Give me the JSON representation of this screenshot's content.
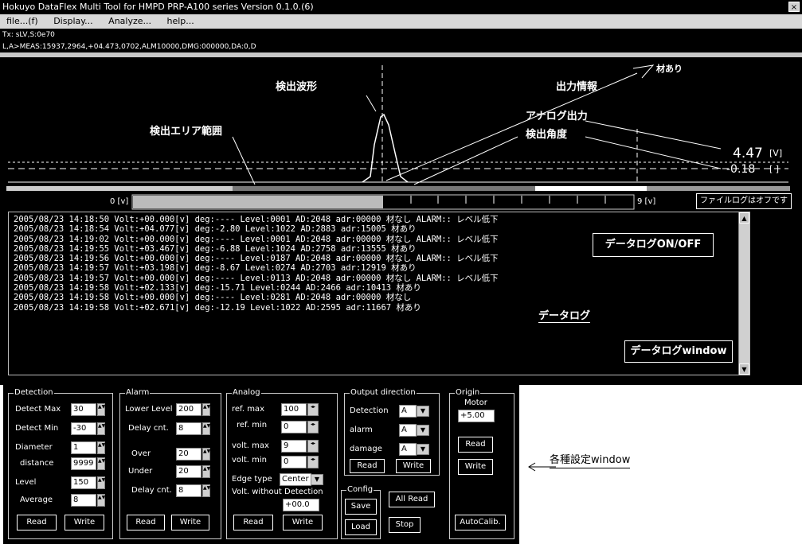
{
  "window": {
    "title": "Hokuyo DataFlex Multi Tool for HMPD PRP-A100 series  Version 0.1.0.(6)",
    "close": "×"
  },
  "menu": [
    "file...(f)",
    "Display...",
    "Analyze...",
    "help..."
  ],
  "status": {
    "line1": "Tx: sLV,S:0e70",
    "line2": "L,A>MEAS:15937,2964,+04.473,0702,ALM10000,DMG:000000,DA:0,D"
  },
  "annotations": {
    "waveform": "検出波形",
    "output_info": "出力情報",
    "area": "検出エリア範囲",
    "analog": "アナログ出力",
    "angle": "検出角度",
    "material": "材あり",
    "datalog_onoff": "データログON/OFF",
    "datalog": "データログ",
    "datalog_window": "データログwindow",
    "settings_window": "各種設定window"
  },
  "readout": {
    "volt": "4.47",
    "volt_unit": "[V]",
    "deg": "-0.18",
    "deg_unit": "[ ]"
  },
  "scale": {
    "min": "0 [v]",
    "max": "9 [v]"
  },
  "log_toggle": "ファイルログはオフです",
  "log": [
    "2005/08/23 14:18:50 Volt:+00.000[v] deg:---- Level:0001 AD:2048 adr:00000 材なし ALARM:: レベル低下",
    "2005/08/23 14:18:54 Volt:+04.077[v] deg:-2.80 Level:1022 AD:2883 adr:15005 材あり",
    "2005/08/23 14:19:02 Volt:+00.000[v] deg:---- Level:0001 AD:2048 adr:00000 材なし ALARM:: レベル低下",
    "2005/08/23 14:19:55 Volt:+03.467[v] deg:-6.88 Level:1024 AD:2758 adr:13555 材あり",
    "2005/08/23 14:19:56 Volt:+00.000[v] deg:---- Level:0187 AD:2048 adr:00000 材なし ALARM:: レベル低下",
    "2005/08/23 14:19:57 Volt:+03.198[v] deg:-8.67 Level:0274 AD:2703 adr:12919 材あり",
    "2005/08/23 14:19:57 Volt:+00.000[v] deg:---- Level:0113 AD:2048 adr:00000 材なし ALARM:: レベル低下",
    "2005/08/23 14:19:58 Volt:+02.133[v] deg:-15.71 Level:0244 AD:2466 adr:10413 材あり",
    "2005/08/23 14:19:58 Volt:+00.000[v] deg:---- Level:0281 AD:2048 adr:00000 材なし",
    "2005/08/23 14:19:58 Volt:+02.671[v] deg:-12.19 Level:1022 AD:2595 adr:11667 材あり"
  ],
  "detection": {
    "title": "Detection",
    "detect_max_label": "Detect Max",
    "detect_max": "30",
    "detect_min_label": "Detect Min",
    "detect_min": "-30",
    "diameter_label": "Diameter",
    "diameter": "1",
    "distance_label": "distance",
    "distance": "9999",
    "level_label": "Level",
    "level": "150",
    "average_label": "Average",
    "average": "8"
  },
  "alarm": {
    "title": "Alarm",
    "lower_label": "Lower Level",
    "lower": "200",
    "delay1_label": "Delay cnt.",
    "delay1": "8",
    "over_label": "Over",
    "over": "20",
    "under_label": "Under",
    "under": "20",
    "delay2_label": "Delay cnt.",
    "delay2": "8"
  },
  "analog": {
    "title": "Analog",
    "refmax_label": "ref. max",
    "refmax": "100",
    "refmin_label": "ref. min",
    "refmin": "0",
    "voltmax_label": "volt. max",
    "voltmax": "9",
    "voltmin_label": "volt. min",
    "voltmin": "0",
    "edge_label": "Edge type",
    "edge": "Center",
    "without_label": "Volt. without Detection",
    "without": "+00.0"
  },
  "output": {
    "title": "Output direction",
    "detection_label": "Detection",
    "detection": "A",
    "alarm_label": "alarm",
    "alarm": "A",
    "damage_label": "damage",
    "damage": "A"
  },
  "config": {
    "title": "Config",
    "save": "Save",
    "load": "Load"
  },
  "origin": {
    "title": "Origin",
    "motor_label": "Motor",
    "motor": "+5.00",
    "read": "Read",
    "write": "Write",
    "autocalib": "AutoCalib."
  },
  "buttons": {
    "read": "Read",
    "write": "Write",
    "allread": "All Read",
    "stop": "Stop"
  }
}
